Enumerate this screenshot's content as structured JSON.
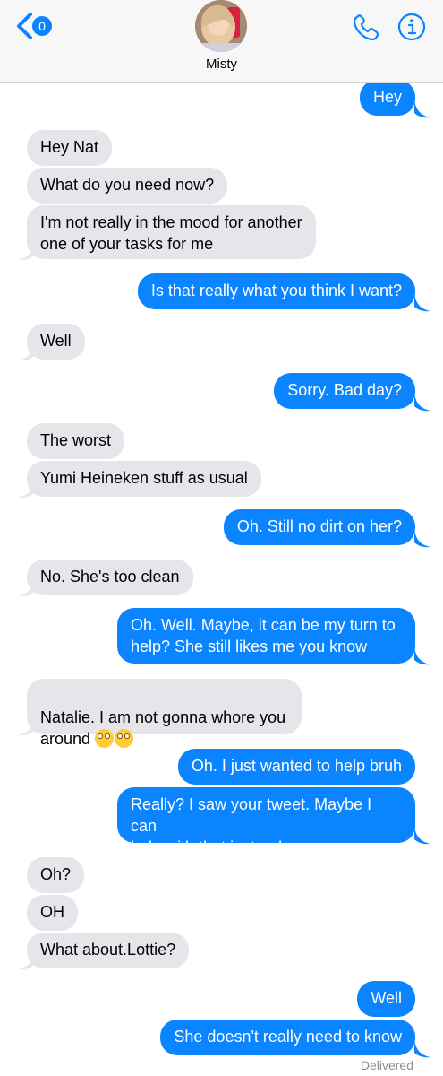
{
  "header": {
    "back_badge": "0",
    "contact_name": "Misty",
    "icons": {
      "back": "chevron-left-icon",
      "phone": "phone-icon",
      "info": "info-icon"
    }
  },
  "colors": {
    "outgoing": "#0a84ff",
    "incoming": "#e5e5ea",
    "header_bg": "#f7f7f7"
  },
  "messages": [
    {
      "from": "me",
      "text": "Hey"
    },
    {
      "from": "them",
      "text": "Hey Nat"
    },
    {
      "from": "them",
      "text": "What do you need now?"
    },
    {
      "from": "them",
      "text": "I'm not really in the mood for another\none of your tasks for me"
    },
    {
      "from": "me",
      "text": "Is that really what you think I want?"
    },
    {
      "from": "them",
      "text": "Well"
    },
    {
      "from": "me",
      "text": "Sorry. Bad day?"
    },
    {
      "from": "them",
      "text": "The worst"
    },
    {
      "from": "them",
      "text": "Yumi Heineken stuff as usual"
    },
    {
      "from": "me",
      "text": "Oh. Still no dirt on her?"
    },
    {
      "from": "them",
      "text": "No. She's too clean"
    },
    {
      "from": "me",
      "text": "Oh. Well. Maybe, it can be my turn to\nhelp? She still likes me you know"
    },
    {
      "from": "them",
      "text": "Natalie. I am not gonna whore you\naround",
      "emoji": "eye-roll-emoji"
    },
    {
      "from": "me",
      "text": "Oh. I just wanted to help bruh"
    },
    {
      "from": "me",
      "text": "Really? I saw your tweet. Maybe I can\nhelp with that instead"
    },
    {
      "from": "them",
      "text": "Oh?"
    },
    {
      "from": "them",
      "text": "OH"
    },
    {
      "from": "them",
      "text": "What about.Lottie?"
    },
    {
      "from": "me",
      "text": "Well"
    },
    {
      "from": "me",
      "text": "She doesn't really need to know"
    }
  ],
  "status": {
    "delivered": "Delivered"
  }
}
